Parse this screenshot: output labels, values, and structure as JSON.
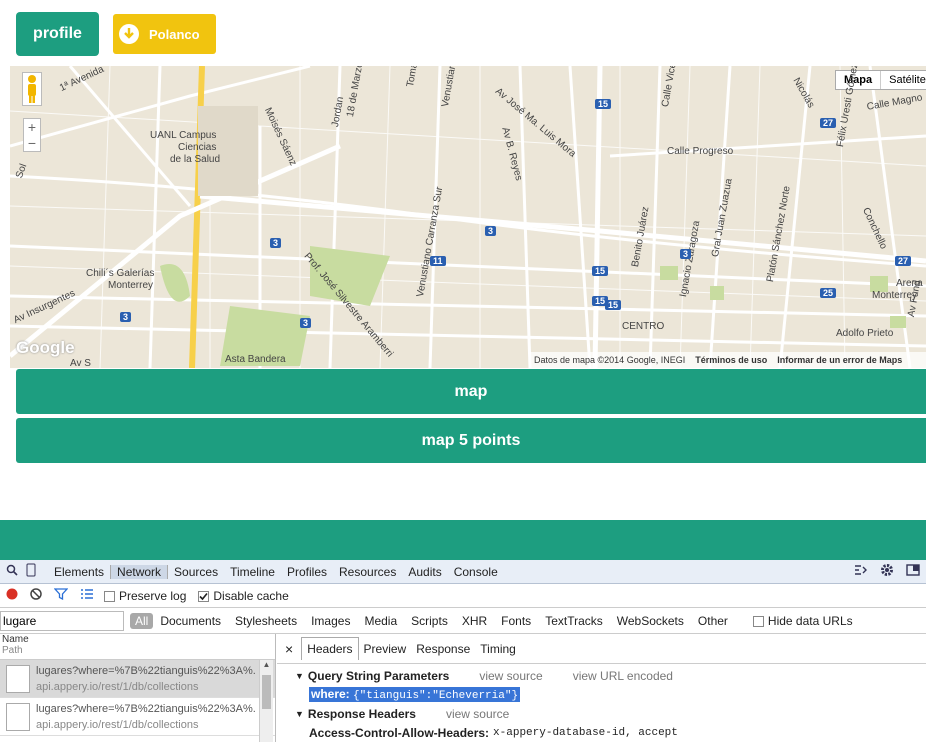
{
  "top": {
    "profile": "profile",
    "location": "Polanco"
  },
  "map": {
    "type_map": "Mapa",
    "type_sat": "Satélite",
    "zoom_in": "+",
    "zoom_out": "−",
    "attribution": "Datos de mapa ©2014 Google, INEGI",
    "terms": "Términos de uso",
    "report": "Informar de un error de Maps",
    "logo": "Google",
    "labels": [
      {
        "id": "avenida",
        "t": "1ª Avenida"
      },
      {
        "id": "uanl",
        "t": "UANL Campus"
      },
      {
        "id": "ciencias",
        "t": "Ciencias"
      },
      {
        "id": "salud",
        "t": "de la Salud"
      },
      {
        "id": "moises",
        "t": "Moisés Sáenz"
      },
      {
        "id": "jordan",
        "t": "Jordan"
      },
      {
        "id": "mayo",
        "t": "18 de Marzo"
      },
      {
        "id": "tomas",
        "t": "Tomás Alba"
      },
      {
        "id": "venus",
        "t": "Venustiano Carranza"
      },
      {
        "id": "josema",
        "t": "Av José Ma. Luis Mora"
      },
      {
        "id": "reyes",
        "t": "Av B. Reyes"
      },
      {
        "id": "vicente",
        "t": "Calle Vicente"
      },
      {
        "id": "progreso",
        "t": "Calle Progreso"
      },
      {
        "id": "nicolas",
        "t": "Nicolás"
      },
      {
        "id": "magno",
        "t": "Calle Magno"
      },
      {
        "id": "felix",
        "t": "Félix Uresti Gómez"
      },
      {
        "id": "conchello",
        "t": "Conchello"
      },
      {
        "id": "sol",
        "t": "Sol"
      },
      {
        "id": "chilis",
        "t": "Chili´s Galerías"
      },
      {
        "id": "monterrey",
        "t": "Monterrey"
      },
      {
        "id": "insurgentes",
        "t": "Av Insurgentes"
      },
      {
        "id": "silvestre",
        "t": "Prof. José Silvestre Aramberri"
      },
      {
        "id": "carrsur",
        "t": "Venustiano Carranza Sur"
      },
      {
        "id": "benito",
        "t": "Benito Juárez"
      },
      {
        "id": "zaragoza",
        "t": "Ignacio Zaragoza"
      },
      {
        "id": "zuazua",
        "t": "Gral Juan Zuazua"
      },
      {
        "id": "platon",
        "t": "Platón Sánchez Norte"
      },
      {
        "id": "centro",
        "t": "CENTRO"
      },
      {
        "id": "adolfo",
        "t": "Adolfo Prieto"
      },
      {
        "id": "arena",
        "t": "Arena"
      },
      {
        "id": "arenamty",
        "t": "Monterrey"
      },
      {
        "id": "fund",
        "t": "Av Fund"
      },
      {
        "id": "bandera",
        "t": "Asta Bandera"
      },
      {
        "id": "avs",
        "t": "Av S"
      }
    ],
    "shields": [
      "15",
      "27",
      "3",
      "11",
      "3",
      "15",
      "3",
      "15",
      "25",
      "27",
      "3",
      "3",
      "15"
    ]
  },
  "buttons": {
    "map": "map",
    "map5": "map 5 points"
  },
  "devtools": {
    "tabs": [
      "Elements",
      "Network",
      "Sources",
      "Timeline",
      "Profiles",
      "Resources",
      "Audits",
      "Console"
    ],
    "preserve_log": "Preserve log",
    "disable_cache": "Disable cache",
    "filter_value": "lugare",
    "filter_types": [
      "All",
      "Documents",
      "Stylesheets",
      "Images",
      "Media",
      "Scripts",
      "XHR",
      "Fonts",
      "TextTracks",
      "WebSockets",
      "Other"
    ],
    "hide_data_urls": "Hide data URLs",
    "list_header_name": "Name",
    "list_header_path": "Path",
    "requests": [
      {
        "name": "lugares?where=%7B%22tianguis%22%3A%...",
        "path": "api.appery.io/rest/1/db/collections"
      },
      {
        "name": "lugares?where=%7B%22tianguis%22%3A%...",
        "path": "api.appery.io/rest/1/db/collections"
      }
    ],
    "detail_tabs": [
      "Headers",
      "Preview",
      "Response",
      "Timing"
    ],
    "close": "×",
    "qsp_title": "Query String Parameters",
    "view_source": "view source",
    "view_url_encoded": "view URL encoded",
    "where_key": "where:",
    "where_val": "{\"tianguis\":\"Echeverria\"}",
    "resp_title": "Response Headers",
    "resp_view_source": "view source",
    "acah_key": "Access-Control-Allow-Headers:",
    "acah_val": "x-appery-database-id, accept"
  },
  "colors": {
    "accent": "#1d9e80",
    "yellow": "#f1c40f",
    "road_yellow": "#f7d04a"
  }
}
